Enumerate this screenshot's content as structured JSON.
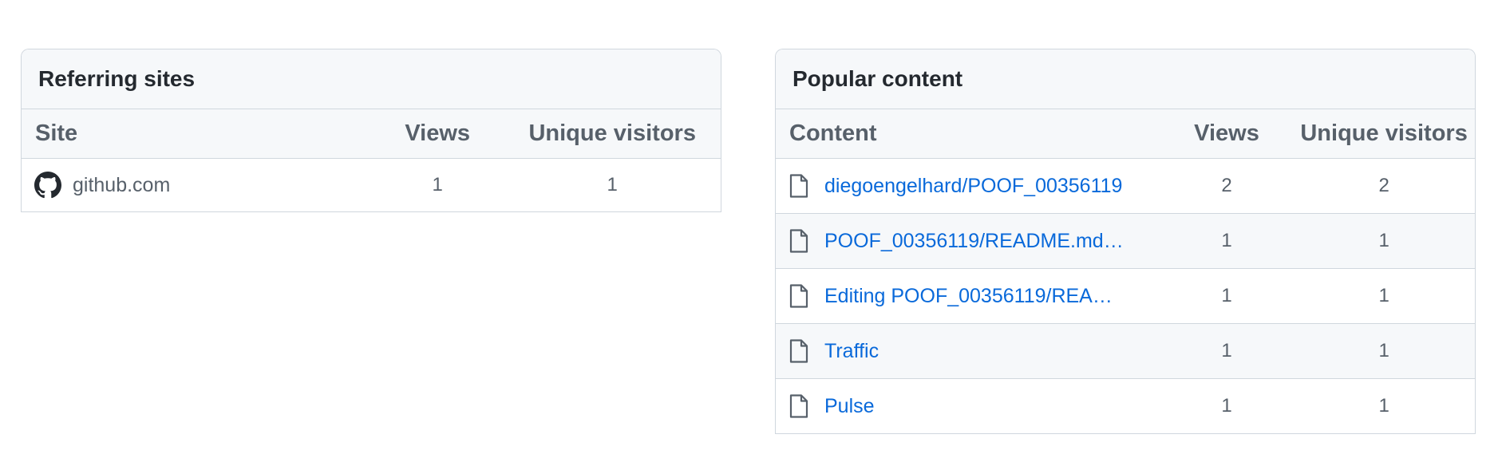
{
  "referring": {
    "title": "Referring sites",
    "columns": {
      "site": "Site",
      "views": "Views",
      "unique": "Unique visitors"
    },
    "rows": [
      {
        "site": "github.com",
        "icon": "github-icon",
        "views": "1",
        "unique": "1"
      }
    ]
  },
  "popular": {
    "title": "Popular content",
    "columns": {
      "content": "Content",
      "views": "Views",
      "unique": "Unique visitors"
    },
    "rows": [
      {
        "label": "diegoengelhard/POOF_00356119",
        "icon": "file-icon",
        "views": "2",
        "unique": "2"
      },
      {
        "label": "POOF_00356119/README.md …",
        "icon": "file-icon",
        "views": "1",
        "unique": "1"
      },
      {
        "label": "Editing POOF_00356119/READ…",
        "icon": "file-icon",
        "views": "1",
        "unique": "1"
      },
      {
        "label": "Traffic",
        "icon": "file-icon",
        "views": "1",
        "unique": "1"
      },
      {
        "label": "Pulse",
        "icon": "file-icon",
        "views": "1",
        "unique": "1"
      }
    ]
  },
  "colors": {
    "link": "#0969da",
    "muted": "#57606a",
    "header_bg": "#f6f8fa",
    "border": "#d0d7de"
  }
}
